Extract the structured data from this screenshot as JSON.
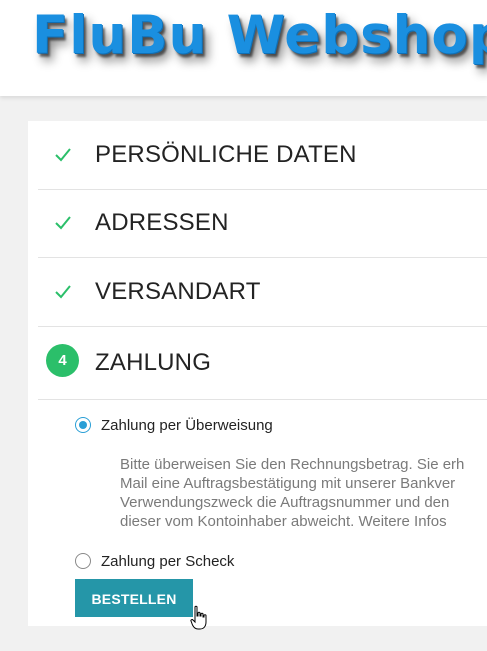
{
  "header": {
    "logo_text": "FluBu Webshop"
  },
  "checkout": {
    "steps": [
      {
        "title": "PERSÖNLICHE DATEN",
        "status": "complete",
        "icon": "check-icon"
      },
      {
        "title": "ADRESSEN",
        "status": "complete",
        "icon": "check-icon"
      },
      {
        "title": "VERSANDART",
        "status": "complete",
        "icon": "check-icon"
      },
      {
        "title": "ZAHLUNG",
        "status": "current",
        "number": "4"
      }
    ],
    "payment": {
      "options": [
        {
          "label": "Zahlung per Überweisung",
          "selected": true
        },
        {
          "label": "Zahlung per Scheck",
          "selected": false
        }
      ],
      "info_lines": [
        "Bitte überweisen Sie den Rechnungsbetrag. Sie erh",
        "Mail eine Auftragsbestätigung mit unserer Bankver",
        "Verwendungszweck die Auftragsnummer und den",
        "dieser vom Kontoinhaber abweicht. Weitere Infos"
      ]
    },
    "order_button_label": "BESTELLEN"
  },
  "colors": {
    "logo": "#1a8fe0",
    "check": "#2bbf6a",
    "step_badge": "#2bbf6a",
    "radio_selected": "#2a9fd6",
    "button": "#2596a8"
  }
}
